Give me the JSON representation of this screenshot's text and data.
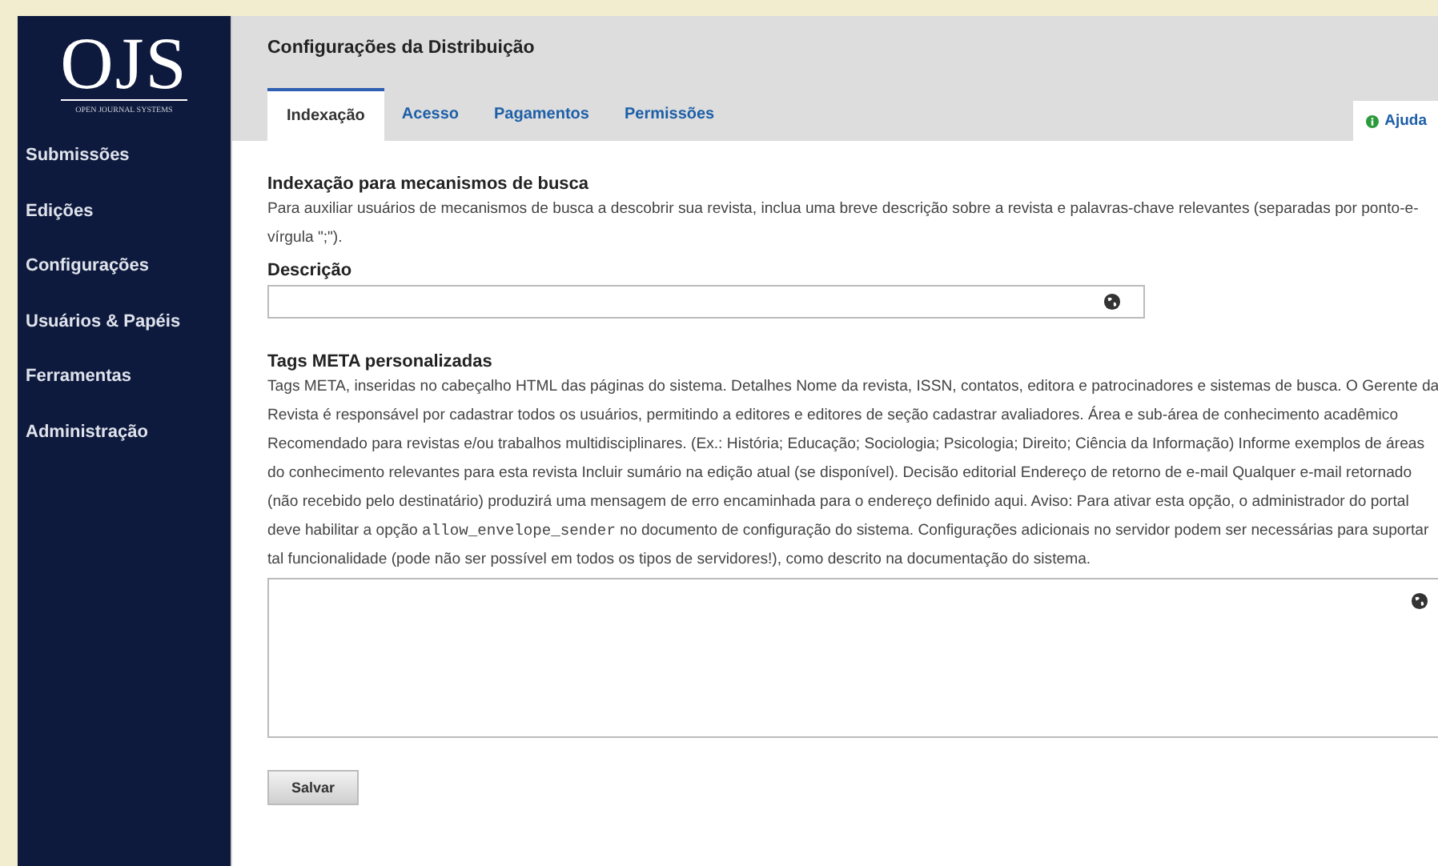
{
  "logo": {
    "text": "OJS",
    "subtitle": "OPEN JOURNAL SYSTEMS"
  },
  "sidebar": {
    "items": [
      {
        "label": "Submissões",
        "selected": false
      },
      {
        "label": "Edições",
        "selected": false
      },
      {
        "label": "Configurações",
        "selected": false
      },
      {
        "label": "Usuários & Papéis",
        "selected": false
      },
      {
        "label": "Ferramentas",
        "selected": false
      },
      {
        "label": "Administração",
        "selected": false
      }
    ]
  },
  "page_title": "Configurações da Distribuição",
  "tabs": [
    {
      "label": "Indexação",
      "selected": true
    },
    {
      "label": "Acesso",
      "selected": false
    },
    {
      "label": "Pagamentos",
      "selected": false
    },
    {
      "label": "Permissões",
      "selected": false
    }
  ],
  "help": {
    "label": "Ajuda"
  },
  "sections": [
    {
      "title": "Indexação para mecanismos de busca",
      "description": [
        {
          "kind": "text",
          "text": "Para auxiliar usuários de mecanismos de busca a descobrir sua revista, inclua uma breve descrição sobre a revista e palavras-chave relevantes (separadas por ponto-e-vírgula \";\")."
        }
      ],
      "field": {
        "kind": "input",
        "label": "Descrição"
      }
    },
    {
      "title": "Tags META personalizadas",
      "description": [
        {
          "kind": "text",
          "text": "Tags META, inseridas no cabeçalho HTML das páginas do sistema. Detalhes Nome da revista, ISSN, contatos, editora e patrocinadores e sistemas de busca. O Gerente da Revista é responsável por cadastrar todos os usuários, permitindo a editores e editores de seção cadastrar avaliadores. Área e sub-área de conhecimento acadêmico Recomendado para revistas e/ou trabalhos multidisciplinares. (Ex.: História; Educação; Sociologia; Psicologia; Direito; Ciência da Informação) Informe exemplos de áreas do conhecimento relevantes para esta revista Incluir sumário na edição atual (se disponível). Decisão editorial Endereço de retorno de e-mail Qualquer e-mail retornado (não recebido pelo destinatário) produzirá uma mensagem de erro encaminhada para o endereço definido aqui. Aviso: Para ativar esta opção, o administrador do portal deve habilitar a opção "
        },
        {
          "kind": "code",
          "text": "allow_envelope_sender"
        },
        {
          "kind": "text",
          "text": " no documento de configuração do sistema. Configurações adicionais no servidor podem ser necessárias para suportar tal funcionalidade (pode não ser possível em todos os tipos de servidores!), como descrito na documentação do sistema."
        }
      ],
      "field": {
        "kind": "textarea"
      }
    }
  ],
  "buttons": [
    {
      "label": "Salvar"
    }
  ]
}
